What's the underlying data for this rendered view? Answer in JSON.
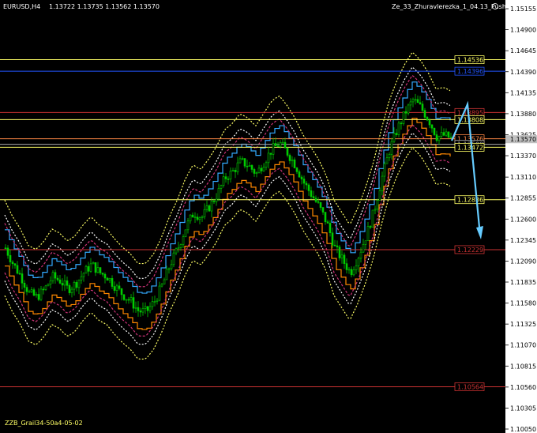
{
  "header": {
    "symbol": "EURUSD,H4",
    "ohlc": "1.13722 1.13735 1.13562 1.13570",
    "indicator": "Ze_33_Zhuravlerezka_1_04.13_Push"
  },
  "footer": {
    "label": "ZZB_Grail34-50a4-05-02"
  },
  "colors": {
    "background": "#000000",
    "candle": "#00cc00",
    "axis_panel": "#ffffff",
    "current_price_label": "#c0c0c0"
  },
  "chart_data": {
    "type": "line",
    "title": "",
    "xlabel": "",
    "ylabel": "",
    "ylim": [
      1.1005,
      1.15165
    ],
    "y_ticks": [
      "1.15155",
      "1.14900",
      "1.14645",
      "1.14390",
      "1.14135",
      "1.13880",
      "1.13625",
      "1.13370",
      "1.13110",
      "1.12855",
      "1.12600",
      "1.12345",
      "1.12090",
      "1.11835",
      "1.11580",
      "1.11325",
      "1.11070",
      "1.10815",
      "1.10560",
      "1.10305",
      "1.10050"
    ],
    "current_price": "1.13570",
    "grid": false,
    "levels": [
      {
        "label": "1.14536",
        "value": 1.14536,
        "color": "#ffff66"
      },
      {
        "label": "1.14396",
        "value": 1.14396,
        "color": "#2255ff"
      },
      {
        "label": "1.13895",
        "value": 1.13895,
        "color": "#cc3333"
      },
      {
        "label": "1.13808",
        "value": 1.13808,
        "color": "#ffff66"
      },
      {
        "label": "1.13576",
        "value": 1.13576,
        "color": "#ff8844"
      },
      {
        "label": "1.13508",
        "value": 1.13508,
        "color": "#aaaaaa"
      },
      {
        "label": "1.13472",
        "value": 1.13472,
        "color": "#ffff66"
      },
      {
        "label": "1.12836",
        "value": 1.12836,
        "color": "#ffff66"
      },
      {
        "label": "1.12229",
        "value": 1.12229,
        "color": "#cc3333"
      },
      {
        "label": "1.10564",
        "value": 1.10564,
        "color": "#cc3333"
      }
    ],
    "series": [
      {
        "values": [
          1.1225,
          1.1205,
          1.119,
          1.117,
          1.1165,
          1.1175,
          1.119,
          1.1185,
          1.1175,
          1.1182,
          1.1195,
          1.1205,
          1.1195,
          1.119,
          1.1178,
          1.1168,
          1.116,
          1.1148,
          1.1148,
          1.116,
          1.118,
          1.1205,
          1.1225,
          1.125,
          1.1268,
          1.1262,
          1.1275,
          1.129,
          1.131,
          1.1318,
          1.133,
          1.1325,
          1.1315,
          1.133,
          1.1345,
          1.1352,
          1.134,
          1.1325,
          1.1305,
          1.129,
          1.1275,
          1.1255,
          1.1225,
          1.121,
          1.1195,
          1.1215,
          1.124,
          1.127,
          1.131,
          1.1345,
          1.137,
          1.139,
          1.1405,
          1.1395,
          1.138,
          1.136,
          1.1362,
          1.1357
        ]
      }
    ]
  }
}
